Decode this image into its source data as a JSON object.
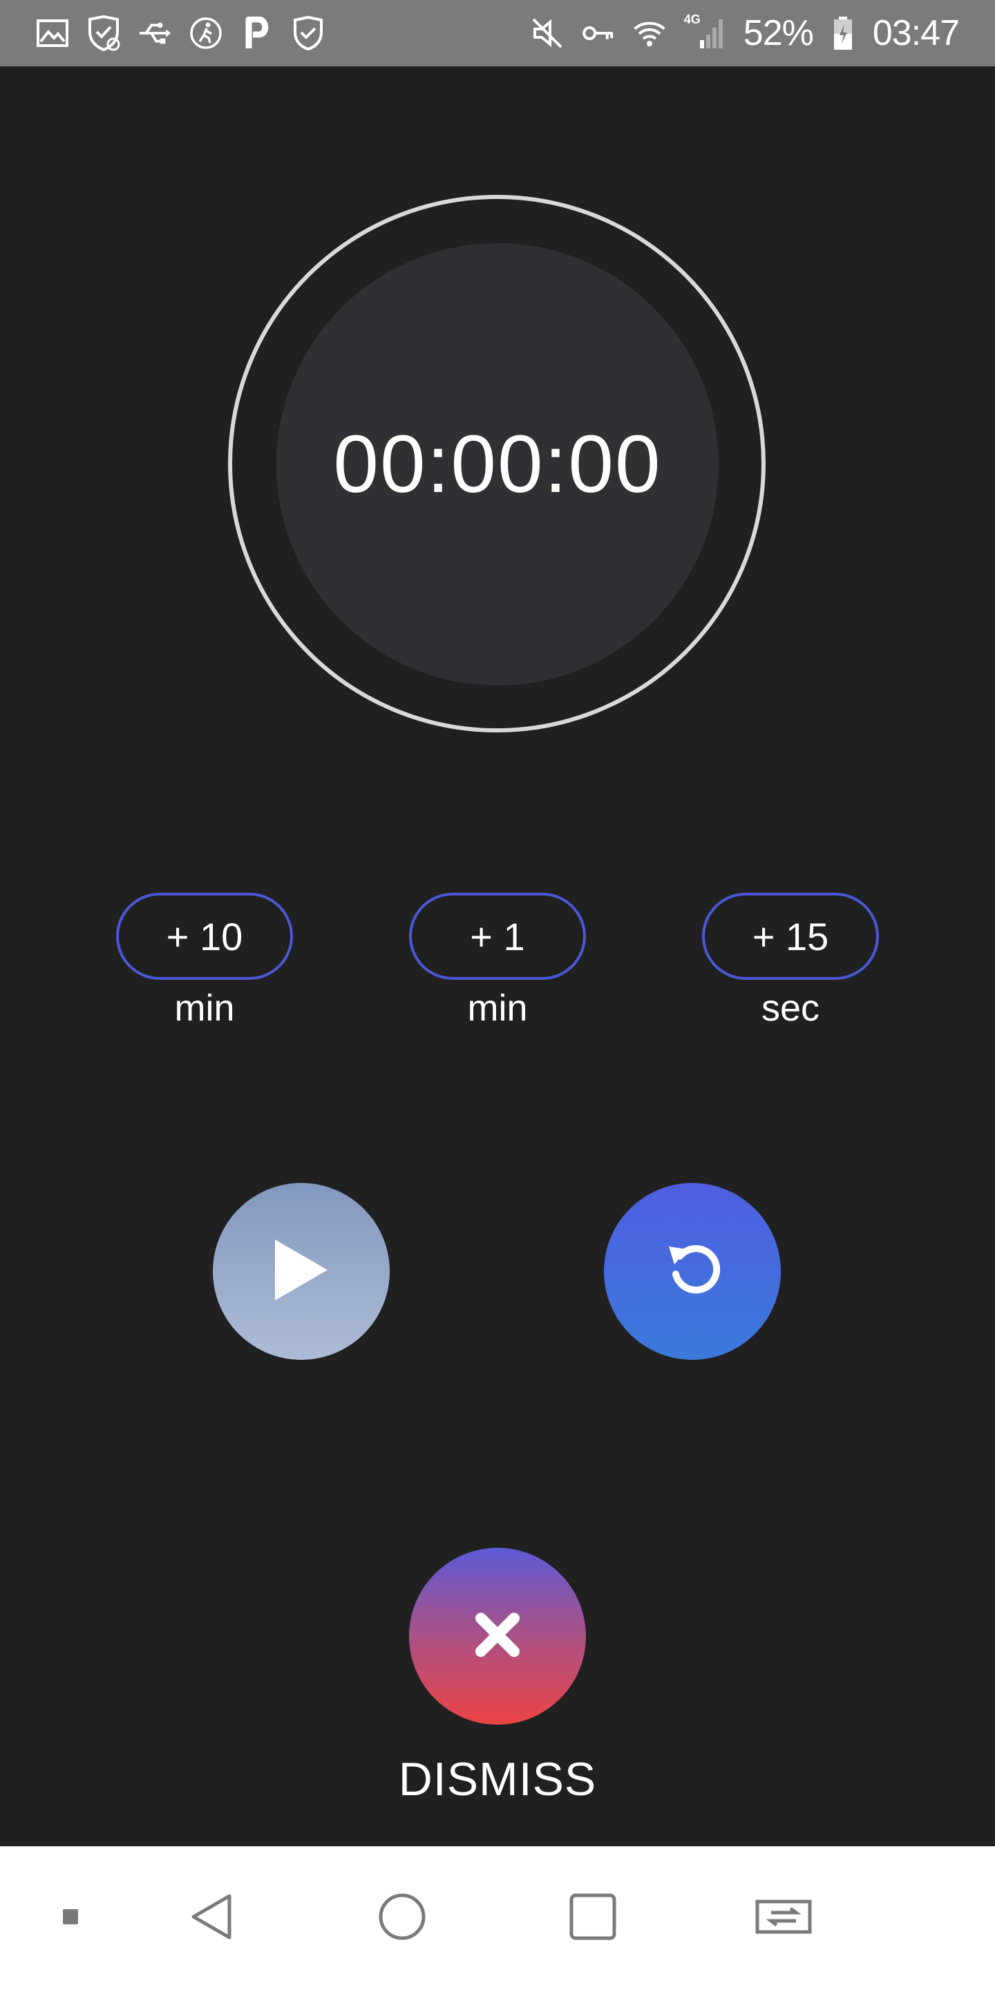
{
  "status_bar": {
    "left_icons": [
      "gallery-icon",
      "shield-sync-icon",
      "usb-icon",
      "walking-icon",
      "p-icon",
      "shield-check-icon"
    ],
    "right_icons": [
      "mute-icon",
      "vpn-key-icon",
      "wifi-icon",
      "signal-4g-icon",
      "battery-icon"
    ],
    "network_label": "4G",
    "battery_percent": "52%",
    "time": "03:47"
  },
  "timer": {
    "display": "00:00:00"
  },
  "increments": [
    {
      "label": "+ 10",
      "unit": "min"
    },
    {
      "label": "+ 1",
      "unit": "min"
    },
    {
      "label": "+ 15",
      "unit": "sec"
    }
  ],
  "controls": {
    "play_icon": "play-icon",
    "reset_icon": "reset-icon",
    "dismiss_icon": "close-icon",
    "dismiss_label": "DISMISS"
  },
  "nav_bar": {
    "items": [
      "notification-dot-icon",
      "back-icon",
      "home-icon",
      "recents-icon",
      "switch-app-icon"
    ]
  },
  "colors": {
    "background": "#202021",
    "accent_blue": "#4b58d6",
    "dismiss_red": "#ec4444",
    "status_bar": "#7b7b7b"
  }
}
